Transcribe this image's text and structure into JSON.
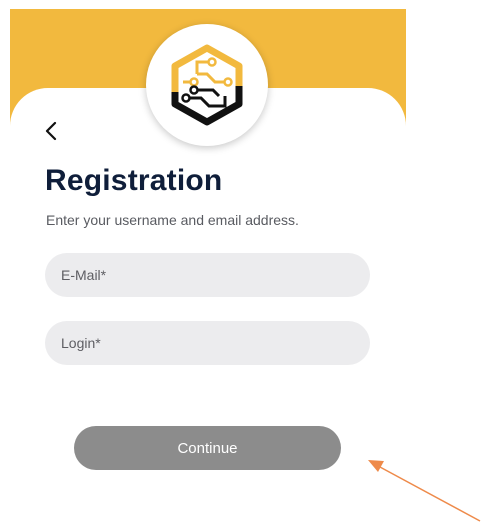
{
  "colors": {
    "header_background": "#f2b93e",
    "title_text": "#0f1e3a",
    "field_background": "#ececee",
    "button_background": "#8c8c8c",
    "annotation_arrow": "#ee8a4a"
  },
  "header": {
    "logo_icon": "circuit-hexagon-icon",
    "back_icon": "chevron-left-icon"
  },
  "main": {
    "title": "Registration",
    "subtitle": "Enter your username and email address."
  },
  "form": {
    "email_placeholder": "E-Mail*",
    "login_placeholder": "Login*",
    "continue_label": "Continue"
  },
  "annotation": {
    "icon": "arrow-icon"
  }
}
